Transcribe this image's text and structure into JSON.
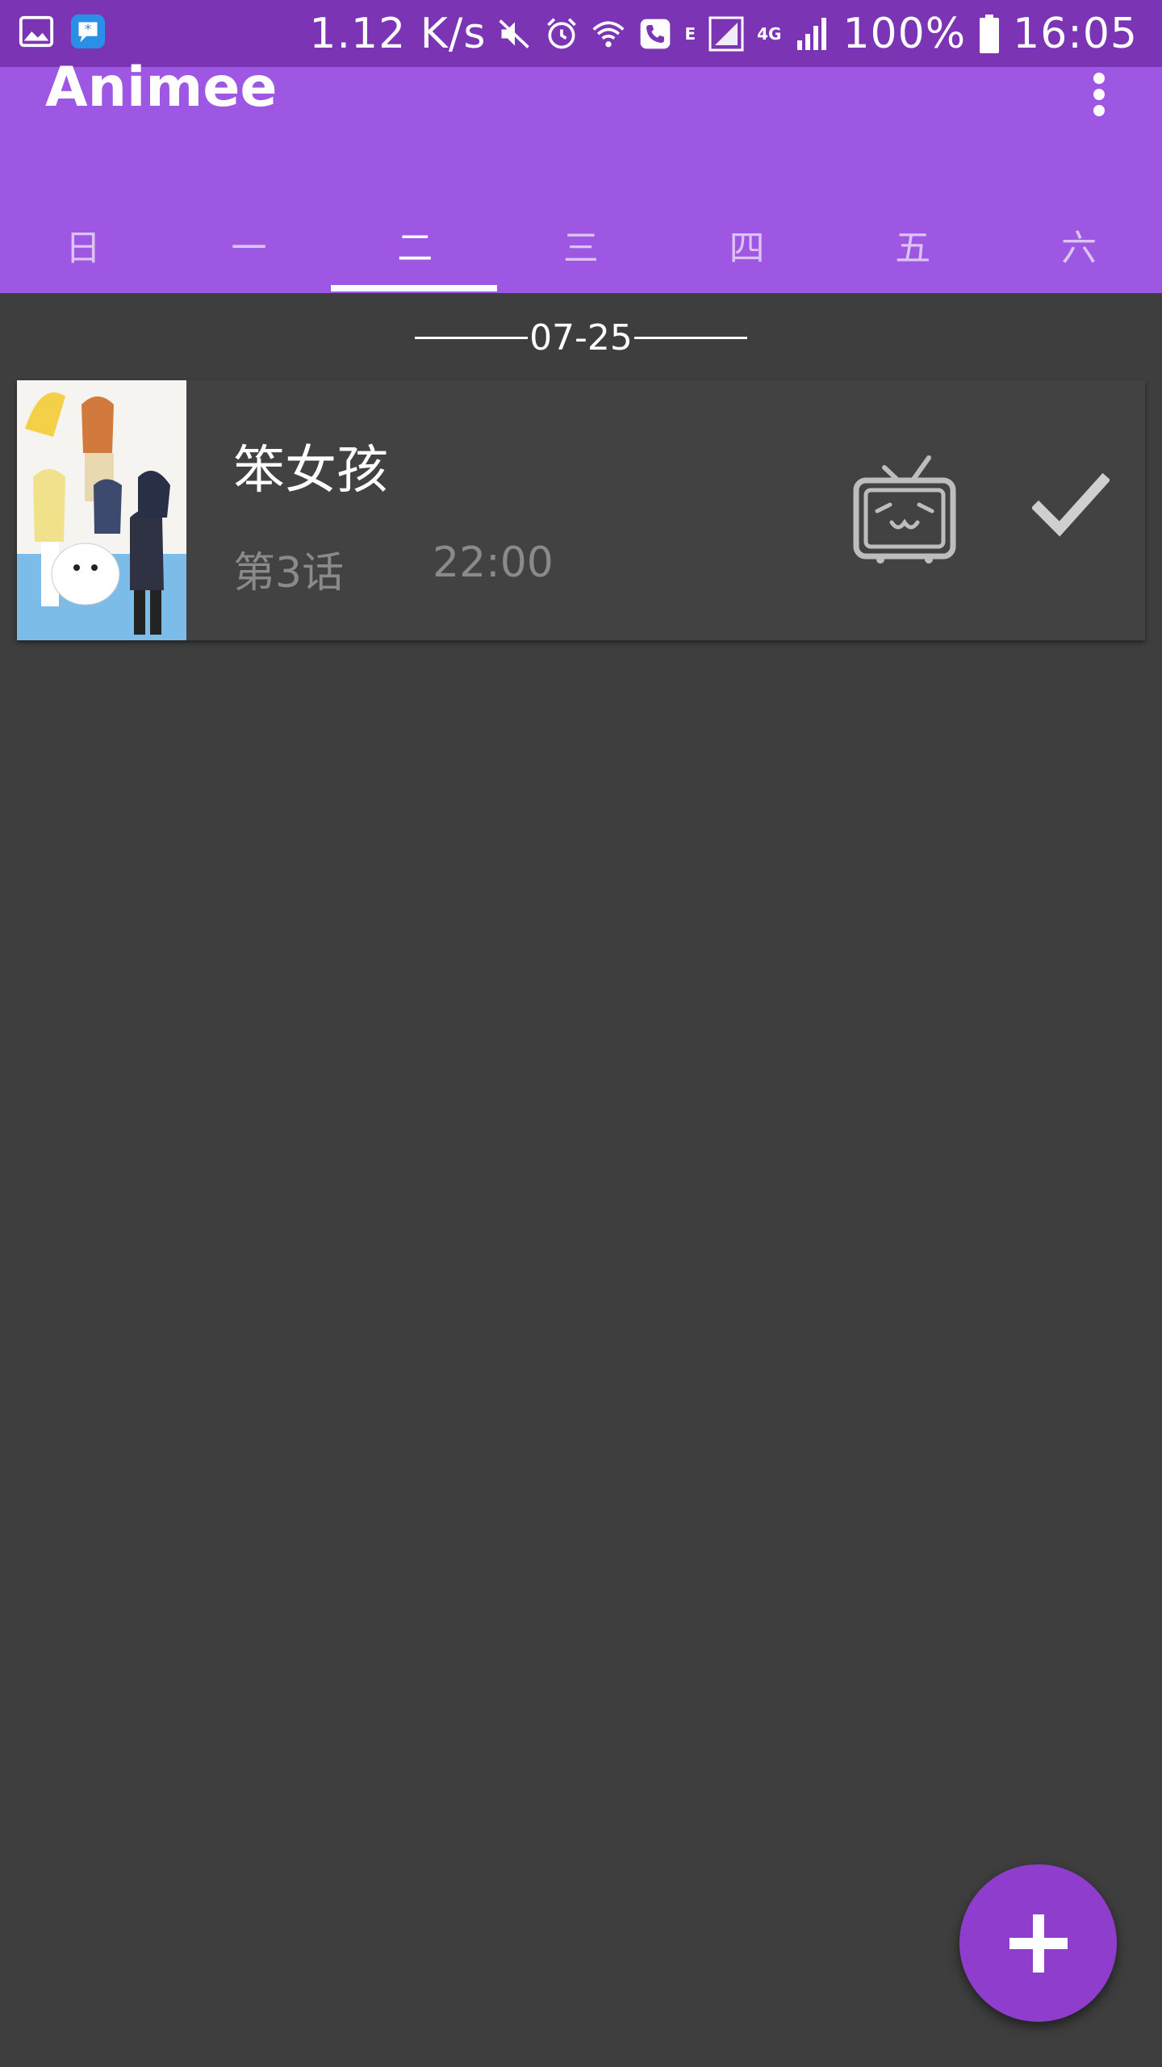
{
  "status_bar": {
    "speed": "1.12 K/s",
    "network_e": "E",
    "network_4g": "4G",
    "battery": "100%",
    "time": "16:05"
  },
  "app_bar": {
    "title": "Animee",
    "tabs": [
      "日",
      "一",
      "二",
      "三",
      "四",
      "五",
      "六"
    ],
    "active_tab_index": 2
  },
  "schedule": {
    "date": "07-25",
    "items": [
      {
        "title": "笨女孩",
        "episode": "第3话",
        "time": "22:00"
      }
    ]
  },
  "colors": {
    "status_bar": "#7b34b3",
    "app_bar": "#9e57e3",
    "background": "#3e3e3e",
    "card": "#424242",
    "fab": "#8e3dcd"
  },
  "icons": [
    "gallery-icon",
    "chat-app-icon",
    "mute-icon",
    "alarm-icon",
    "wifi-icon",
    "call-icon",
    "signal-icon",
    "battery-icon",
    "more-vert-icon",
    "tv-icon",
    "check-icon",
    "plus-icon"
  ]
}
